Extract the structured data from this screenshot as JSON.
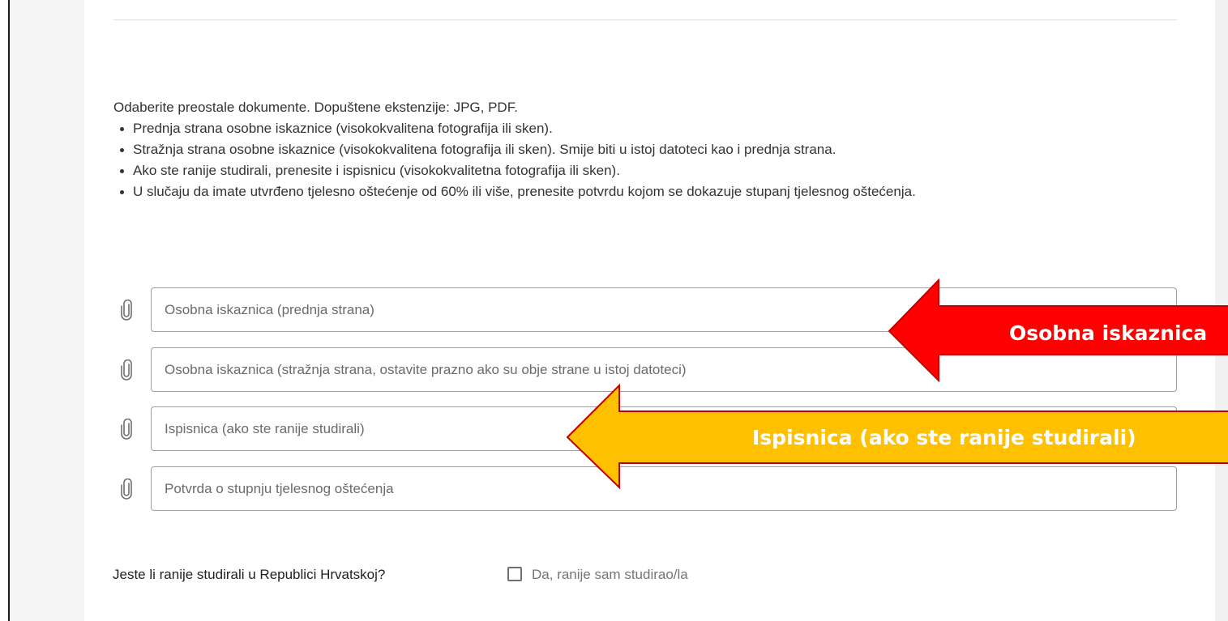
{
  "instructions": {
    "intro": "Odaberite preostale dokumente. Dopuštene ekstenzije: JPG, PDF.",
    "bullets": [
      "Prednja strana osobne iskaznice (visokokvalitena fotografija ili sken).",
      "Stražnja strana osobne iskaznice (visokokvalitena fotografija ili sken). Smije biti u istoj datoteci kao i prednja strana.",
      "Ako ste ranije studirali, prenesite i ispisnicu (visokokvalitetna fotografija ili sken).",
      "U slučaju da imate utvrđeno tjelesno oštećenje od 60% ili više, prenesite potvrdu kojom se dokazuje stupanj tjelesnog oštećenja."
    ]
  },
  "uploads": [
    {
      "placeholder": "Osobna iskaznica (prednja strana)",
      "icon": "paperclip-icon"
    },
    {
      "placeholder": "Osobna iskaznica (stražnja strana, ostavite prazno ako su obje strane u istoj datoteci)",
      "icon": "paperclip-icon"
    },
    {
      "placeholder": "Ispisnica (ako ste ranije studirali)",
      "icon": "paperclip-icon"
    },
    {
      "placeholder": "Potvrda o stupnju tjelesnog oštećenja",
      "icon": "paperclip-icon"
    }
  ],
  "question": {
    "label": "Jeste li ranije studirali u Republici Hrvatskoj?",
    "checkbox_label": "Da, ranije sam studirao/la",
    "checked": false
  },
  "annotations": {
    "red_arrow_label": "Osobna iskaznica",
    "yellow_arrow_label": "Ispisnica (ako ste ranije studirali)",
    "red_color": "#ff0000",
    "yellow_color": "#ffc000"
  },
  "colors": {
    "page_bg": "#f5f5f5",
    "card_bg": "#ffffff",
    "field_border": "#9e9e9e"
  }
}
